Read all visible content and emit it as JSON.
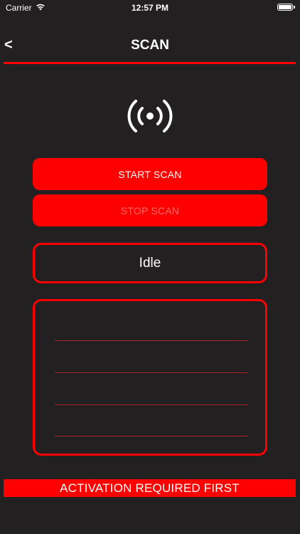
{
  "status_bar": {
    "carrier": "Carrier",
    "time": "12:57 PM",
    "wifi_icon": "wifi-icon",
    "battery_icon": "battery-icon"
  },
  "nav": {
    "back_label": "<",
    "title": "SCAN"
  },
  "scan_icon": "broadcast-icon",
  "buttons": {
    "start": "START SCAN",
    "stop": "STOP SCAN"
  },
  "status": {
    "text": "Idle"
  },
  "results": {
    "items": [
      "",
      "",
      "",
      ""
    ]
  },
  "banner": {
    "text": "ACTIVATION REQUIRED FIRST"
  },
  "colors": {
    "background": "#222021",
    "accent": "#ff0000",
    "text": "#ffffff",
    "disabled_text": "#ff6b6b"
  }
}
